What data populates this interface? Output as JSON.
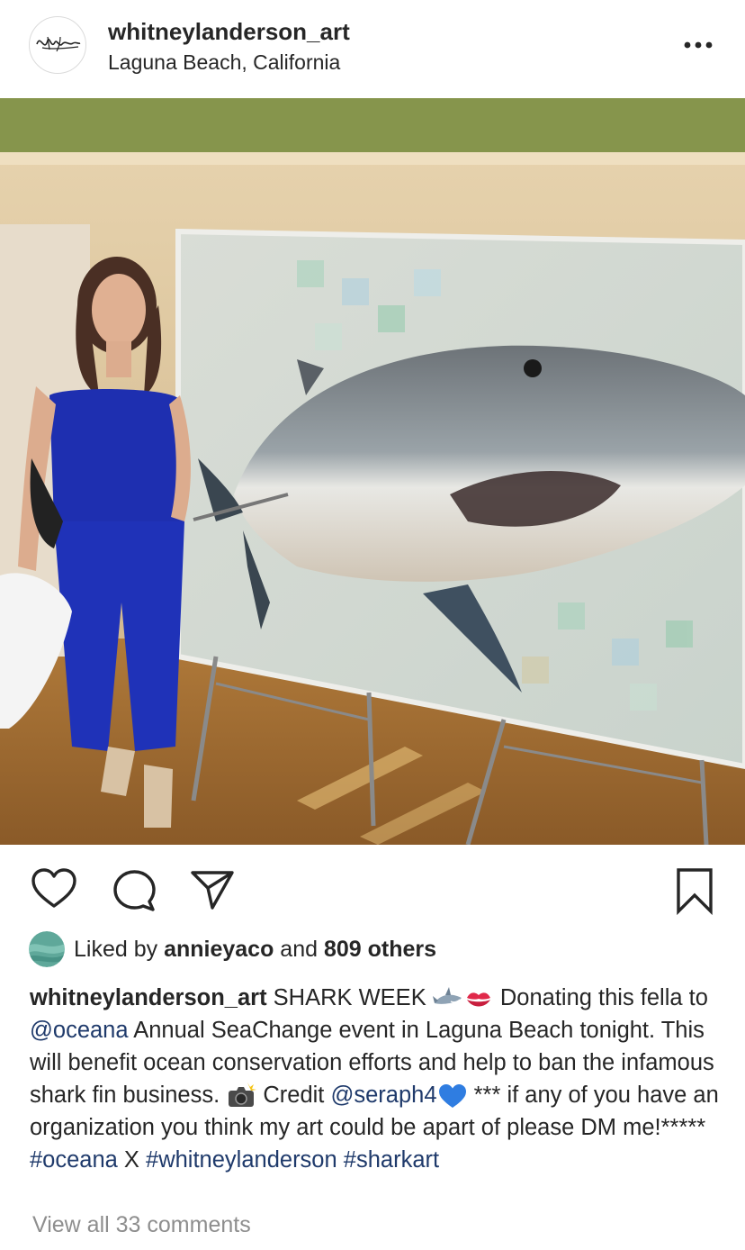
{
  "post": {
    "username": "whitneylanderson_art",
    "location": "Laguna Beach, California",
    "more_icon": "more-horizontal-icon"
  },
  "photo": {
    "icon": "photo-image"
  },
  "actions": {
    "like_icon": "heart-icon",
    "comment_icon": "comment-icon",
    "share_icon": "send-icon",
    "save_icon": "bookmark-icon"
  },
  "likes": {
    "prefix": "Liked by ",
    "liker": "annieyaco",
    "and": " and ",
    "others": "809 others"
  },
  "caption": {
    "username": "whitneylanderson_art",
    "part1": " SHARK WEEK ",
    "part2": " Donating this fella to ",
    "mention1": "@oceana",
    "part3": " Annual SeaChange event in Laguna Beach tonight. This will benefit ocean conservation efforts and help to ban the infamous shark fin business. ",
    "part4": " Credit ",
    "mention2": "@seraph4",
    "part5": " *** if any of you have an organization you think my art could be apart of please DM me!***** ",
    "hashtag1": "#oceana",
    "part6": " X ",
    "hashtag2": "#whitneylanderson",
    "part7": " ",
    "hashtag3": "#sharkart",
    "emojis": [
      "shark-emoji",
      "kiss-mark-emoji",
      "camera-flash-emoji",
      "blue-heart-emoji"
    ]
  },
  "comments": {
    "view_all": "View all 33 comments"
  },
  "colors": {
    "text": "#262626",
    "link": "#1f3a6b",
    "muted": "#8e8e8e"
  }
}
